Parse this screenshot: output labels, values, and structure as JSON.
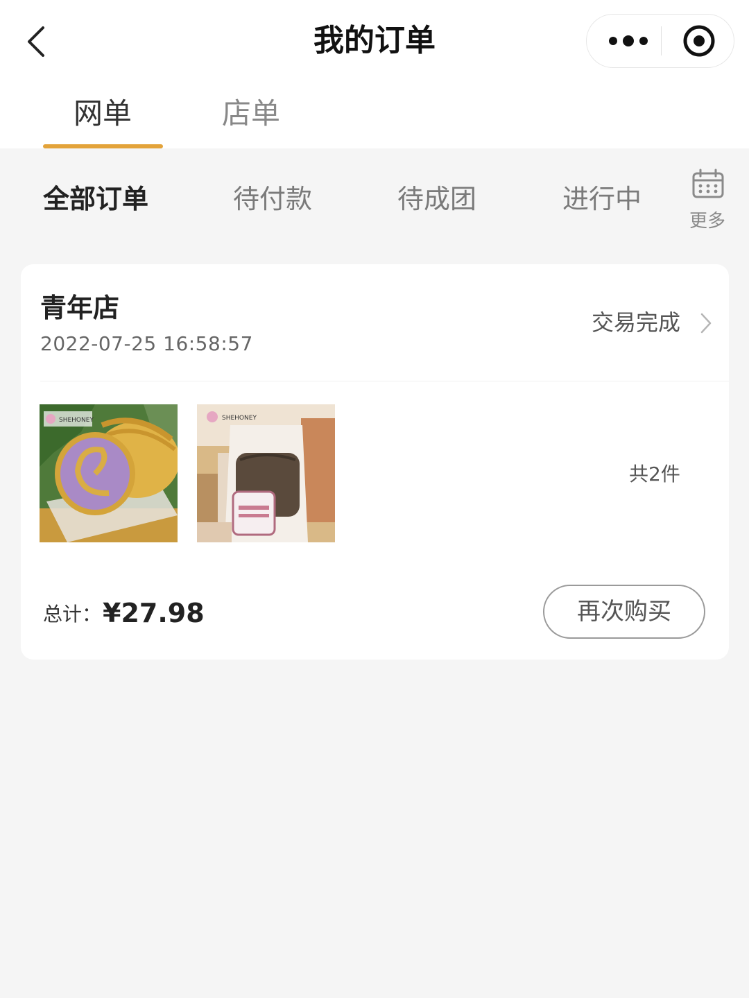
{
  "nav": {
    "title": "我的订单",
    "back_icon": "chevron-left-icon",
    "more_icon": "more-dots-icon",
    "close_icon": "target-circle-icon"
  },
  "top_tabs": [
    {
      "label": "网单",
      "active": true
    },
    {
      "label": "店单",
      "active": false
    }
  ],
  "filters": [
    {
      "label": "全部订单",
      "active": true
    },
    {
      "label": "待付款",
      "active": false
    },
    {
      "label": "待成团",
      "active": false
    },
    {
      "label": "进行中",
      "active": false
    }
  ],
  "filter_more": {
    "label": "更多",
    "icon": "calendar-icon"
  },
  "order": {
    "store_name": "青年店",
    "time": "2022-07-25 16:58:57",
    "status": "交易完成",
    "products": [
      {
        "name": "taro-roll-cake-image",
        "brand_text": "SHEHONEY"
      },
      {
        "name": "black-wheat-bread-image",
        "brand_text": "SHEHONEY"
      }
    ],
    "item_count": "共2件",
    "total_label": "总计：",
    "total_amount": "¥27.98",
    "rebuy_label": "再次购买"
  },
  "colors": {
    "accent": "#e3a33a",
    "background": "#f5f5f5",
    "card": "#ffffff"
  }
}
